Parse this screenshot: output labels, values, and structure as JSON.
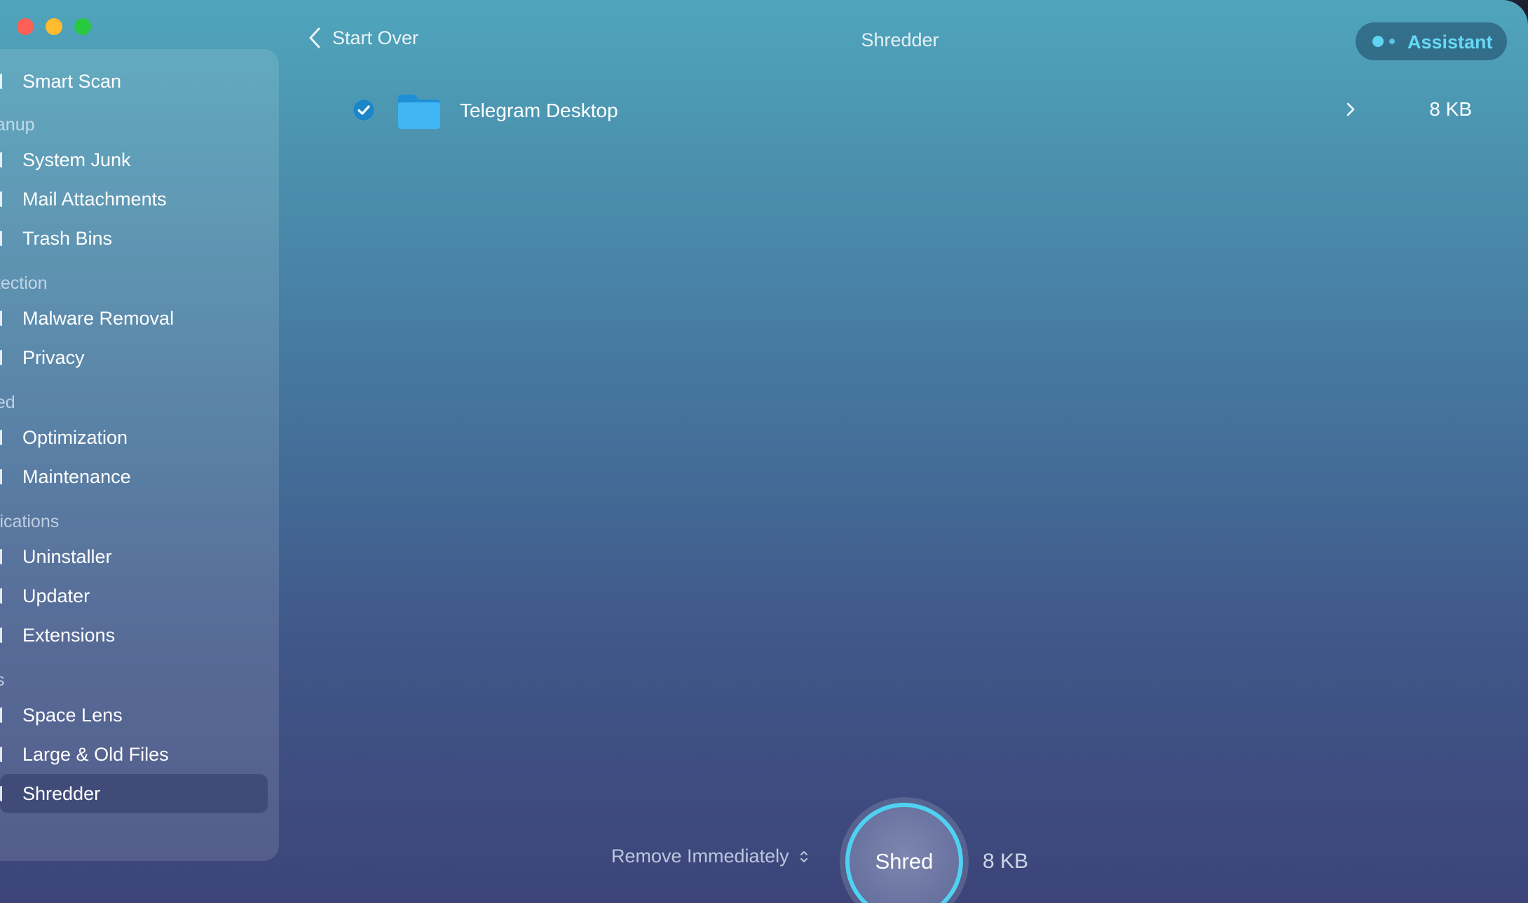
{
  "window": {
    "title": "Shredder"
  },
  "header": {
    "back_label": "Start Over",
    "assistant_label": "Assistant"
  },
  "sidebar": {
    "items": [
      {
        "label": "Smart Scan",
        "icon": "scan-icon"
      },
      {
        "section": "eanup"
      },
      {
        "label": "System Junk",
        "icon": "junk-icon"
      },
      {
        "label": "Mail Attachments",
        "icon": "mail-icon"
      },
      {
        "label": "Trash Bins",
        "icon": "trash-icon"
      },
      {
        "section": "otection"
      },
      {
        "label": "Malware Removal",
        "icon": "malware-icon"
      },
      {
        "label": "Privacy",
        "icon": "privacy-icon"
      },
      {
        "section": "eed"
      },
      {
        "label": "Optimization",
        "icon": "optimization-icon"
      },
      {
        "label": "Maintenance",
        "icon": "maintenance-icon"
      },
      {
        "section": "plications"
      },
      {
        "label": "Uninstaller",
        "icon": "uninstaller-icon"
      },
      {
        "label": "Updater",
        "icon": "updater-icon"
      },
      {
        "label": "Extensions",
        "icon": "extensions-icon"
      },
      {
        "section": "es"
      },
      {
        "label": "Space Lens",
        "icon": "space-lens-icon"
      },
      {
        "label": "Large & Old Files",
        "icon": "files-icon"
      },
      {
        "label": "Shredder",
        "icon": "shredder-icon",
        "active": true
      }
    ]
  },
  "files": [
    {
      "name": "Telegram Desktop",
      "size": "8 KB",
      "checked": true,
      "icon": "folder-icon"
    }
  ],
  "footer": {
    "remove_mode": "Remove Immediately",
    "shred_label": "Shred",
    "total_size": "8 KB"
  },
  "colors": {
    "accent": "#5ed4f2",
    "close": "#fe5f57",
    "minimize": "#febc2e",
    "maximize": "#28c840"
  }
}
